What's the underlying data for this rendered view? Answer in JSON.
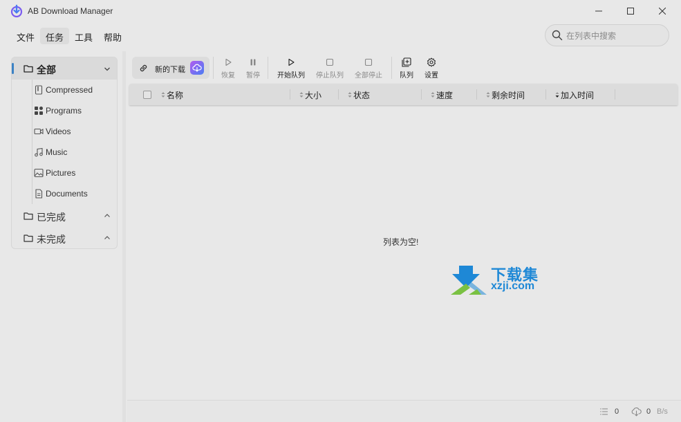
{
  "window": {
    "title": "AB Download Manager"
  },
  "menu": [
    {
      "label": "文件"
    },
    {
      "label": "任务"
    },
    {
      "label": "工具"
    },
    {
      "label": "帮助"
    }
  ],
  "search": {
    "placeholder": "在列表中搜索"
  },
  "sidebar": {
    "all_label": "全部",
    "categories": [
      {
        "label": "Compressed",
        "icon": "zip-file-icon"
      },
      {
        "label": "Programs",
        "icon": "apps-icon"
      },
      {
        "label": "Videos",
        "icon": "video-icon"
      },
      {
        "label": "Music",
        "icon": "music-note-icon"
      },
      {
        "label": "Pictures",
        "icon": "picture-icon"
      },
      {
        "label": "Documents",
        "icon": "document-icon"
      }
    ],
    "completed_label": "已完成",
    "unfinished_label": "未完成",
    "accent_color": "#3b82c4"
  },
  "toolbar": {
    "new_download_label": "新的下载",
    "resume_label": "恢复",
    "pause_label": "暂停",
    "start_queue_label": "开始队列",
    "stop_queue_label": "停止队列",
    "stop_all_label": "全部停止",
    "queue_label": "队列",
    "settings_label": "设置"
  },
  "table": {
    "columns": [
      "名称",
      "大小",
      "状态",
      "速度",
      "剩余时间",
      "加入时间"
    ],
    "empty_text": "列表为空!"
  },
  "watermark": {
    "cn": "下载集",
    "en": "xzji.com"
  },
  "status": {
    "count": "0",
    "speed": "0",
    "speed_unit": "B/s"
  }
}
